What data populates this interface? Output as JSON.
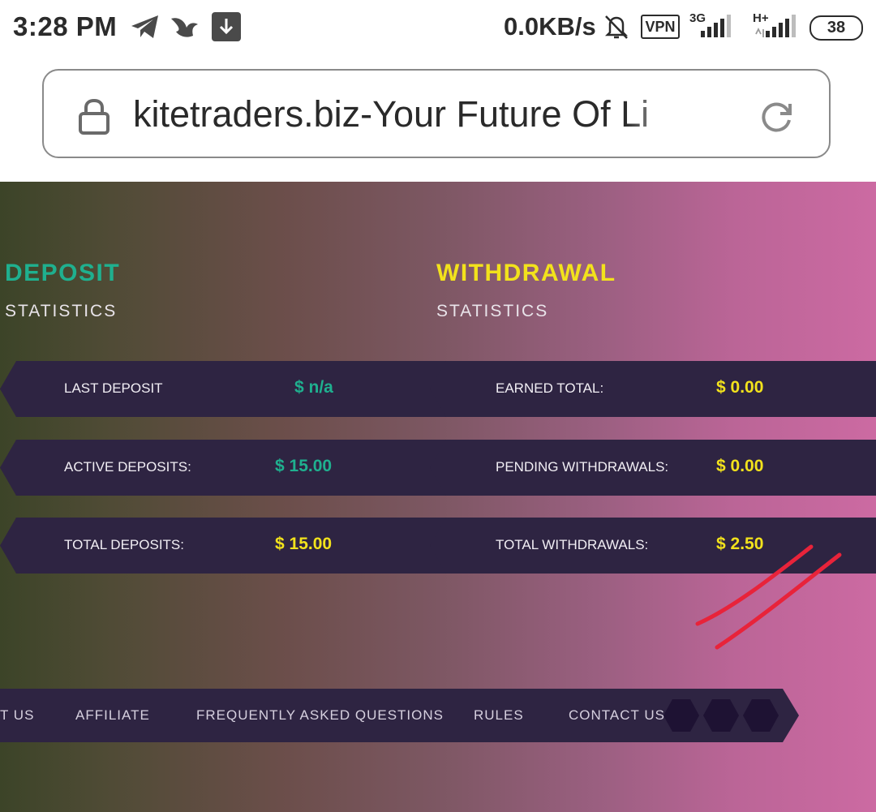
{
  "status_bar": {
    "time": "3:28 PM",
    "network_speed": "0.0KB/s",
    "vpn_label": "VPN",
    "signal1_label": "3G",
    "signal2_label": "H+",
    "battery": "38",
    "icons": [
      "telegram-icon",
      "bird-app-icon",
      "download-icon",
      "bell-muted-icon",
      "signal-icon",
      "signal-icon"
    ]
  },
  "browser": {
    "url_text": "kitetraders.biz-Your Future Of Li",
    "icons": [
      "lock-icon",
      "reload-icon"
    ]
  },
  "deposit": {
    "title": "DEPOSIT",
    "subtitle": "STATISTICS",
    "rows": [
      {
        "label": "LAST DEPOSIT",
        "value": "$ n/a"
      },
      {
        "label": "ACTIVE DEPOSITS:",
        "value": "$ 15.00"
      },
      {
        "label": "TOTAL DEPOSITS:",
        "value": "$ 15.00"
      }
    ]
  },
  "withdrawal": {
    "title": "WITHDRAWAL",
    "subtitle": "STATISTICS",
    "rows": [
      {
        "label": "EARNED TOTAL:",
        "value": "$ 0.00"
      },
      {
        "label": "PENDING WITHDRAWALS:",
        "value": "$ 0.00"
      },
      {
        "label": "TOTAL WITHDRAWALS:",
        "value": "$ 2.50"
      }
    ]
  },
  "nav": {
    "items": [
      "T US",
      "AFFILIATE",
      "FREQUENTLY ASKED QUESTIONS",
      "RULES",
      "CONTACT US"
    ]
  },
  "colors": {
    "deposit_accent": "#1fb08f",
    "withdrawal_accent": "#f2e21c",
    "row_background": "#2e2442",
    "annotation_stroke": "#e8233a"
  }
}
